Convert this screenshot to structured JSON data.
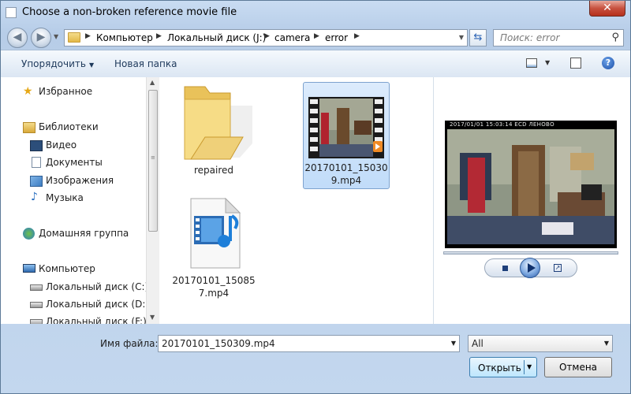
{
  "window": {
    "title": "Choose a non-broken reference movie file",
    "close_glyph": "✕"
  },
  "address_bar": {
    "crumbs": [
      "Компьютер",
      "Локальный диск (J:)",
      "camera",
      "error"
    ],
    "search_placeholder": "Поиск: error"
  },
  "toolbar": {
    "organize_label": "Упорядочить",
    "new_folder_label": "Новая папка"
  },
  "nav_pane": {
    "items": [
      {
        "label": "Избранное",
        "icon": "star-icon"
      },
      {
        "label": "Библиотеки",
        "icon": "libraries-icon"
      },
      {
        "label": "Видео",
        "icon": "video-library-icon"
      },
      {
        "label": "Документы",
        "icon": "documents-library-icon"
      },
      {
        "label": "Изображения",
        "icon": "pictures-library-icon"
      },
      {
        "label": "Музыка",
        "icon": "music-library-icon"
      },
      {
        "label": "Домашняя группа",
        "icon": "homegroup-icon"
      },
      {
        "label": "Компьютер",
        "icon": "computer-icon"
      },
      {
        "label": "Локальный диск (C:)",
        "icon": "drive-icon"
      },
      {
        "label": "Локальный диск (D:)",
        "icon": "drive-icon"
      },
      {
        "label": "Локальный диск (F:)",
        "icon": "drive-icon"
      }
    ]
  },
  "files": [
    {
      "name_line1": "repaired",
      "name_line2": "",
      "type": "folder",
      "selected": false
    },
    {
      "name_line1": "20170101_15030",
      "name_line2": "9.mp4",
      "type": "video-thumbnail",
      "selected": true
    },
    {
      "name_line1": "20170101_15085",
      "name_line2": "7.mp4",
      "type": "media-file",
      "selected": false
    }
  ],
  "preview": {
    "timestamp": "2017/01/01 15:03:14 ECD ЛЕНОВО"
  },
  "bottom": {
    "filename_label": "Имя файла:",
    "filename_value": "20170101_150309.mp4",
    "filter_value": "All",
    "open_label": "Открыть",
    "cancel_label": "Отмена"
  },
  "colors": {
    "selection": "#c1dcf9",
    "accent": "#3c7fb1",
    "close": "#c7513f"
  }
}
